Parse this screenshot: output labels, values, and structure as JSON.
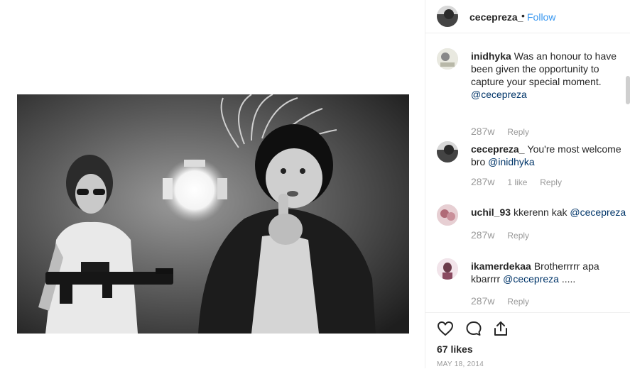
{
  "post": {
    "author": "cecepreza_",
    "dot": "•",
    "follow_label": "Follow",
    "likes": "67 likes",
    "date": "MAY 18, 2014"
  },
  "comments": [
    {
      "username": "inidhyka",
      "text": "Was an honour to have been given the opportunity to capture your special moment.",
      "mention": "@cecepreza",
      "time": "287w",
      "likes": "",
      "reply_label": "Reply"
    },
    {
      "username": "cecepreza_",
      "text": "You're most welcome bro",
      "mention": "@inidhyka",
      "time": "287w",
      "likes": "1 like",
      "reply_label": "Reply"
    },
    {
      "username": "uchil_93",
      "text": "kkerenn kak",
      "mention": "@cecepreza",
      "time": "287w",
      "likes": "",
      "reply_label": "Reply"
    },
    {
      "username": "ikamerdekaa",
      "text": "Brotherrrrr apa kbarrrr",
      "mention": "@cecepreza",
      "suffix": ".....",
      "time": "287w",
      "likes": "",
      "reply_label": "Reply"
    }
  ],
  "icons": {
    "like": "heart-icon",
    "comment": "comment-icon",
    "share": "share-icon"
  },
  "colors": {
    "link": "#3897f0",
    "mention": "#003569",
    "muted": "#999999",
    "text": "#262626"
  }
}
